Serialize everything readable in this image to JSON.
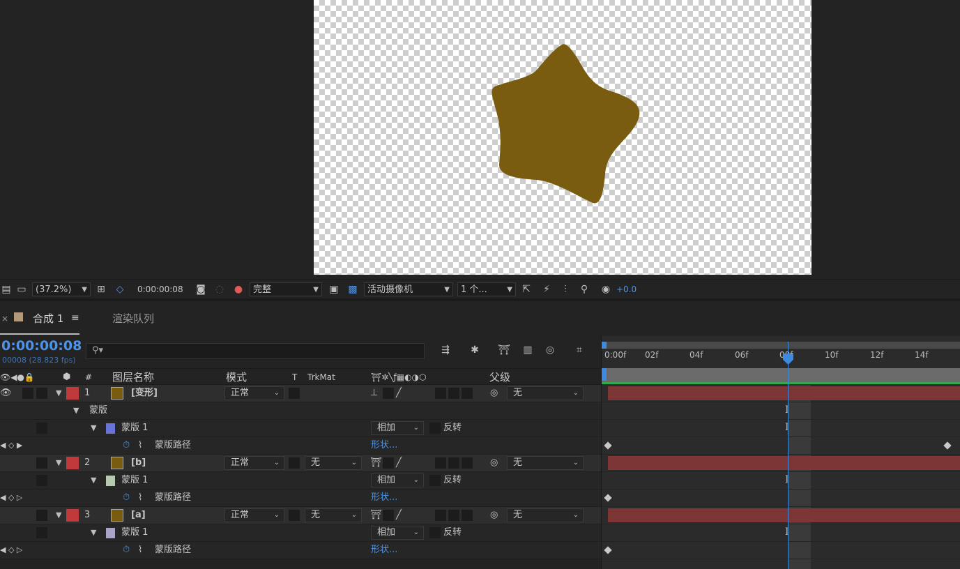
{
  "viewer": {
    "zoom": "(37.2%)",
    "timecode": "0:00:00:08",
    "resolution": "完整",
    "camera": "活动摄像机",
    "views": "1 个...",
    "exposure": "+0.0",
    "star_color": "#7a5c10"
  },
  "tabs": {
    "comp_close": "×",
    "comp_label": "合成 1",
    "menu": "≡",
    "render_queue": "渲染队列"
  },
  "timeline": {
    "current_time": "0:00:00:08",
    "frame_fps": "00008 (28.823 fps)",
    "search_placeholder": "",
    "columns": {
      "num": "#",
      "name": "图层名称",
      "mode": "模式",
      "t": "T",
      "trkmat": "TrkMat",
      "parent": "父级"
    },
    "ruler": [
      "0:00f",
      "02f",
      "04f",
      "06f",
      "08f",
      "10f",
      "12f",
      "14f"
    ],
    "rows": [
      {
        "num": "1",
        "name": "[变形]",
        "mode": "正常",
        "trkmat": "",
        "parent": "无"
      },
      {
        "label": "蒙版"
      },
      {
        "label": "蒙版 1",
        "mask_mode": "相加",
        "invert": "反转"
      },
      {
        "label": "蒙版路径",
        "value": "形状..."
      },
      {
        "num": "2",
        "name": "[b]",
        "mode": "正常",
        "trkmat": "无",
        "parent": "无"
      },
      {
        "label": "蒙版 1",
        "mask_mode": "相加",
        "invert": "反转"
      },
      {
        "label": "蒙版路径",
        "value": "形状..."
      },
      {
        "num": "3",
        "name": "[a]",
        "mode": "正常",
        "trkmat": "无",
        "parent": "无"
      },
      {
        "label": "蒙版 1",
        "mask_mode": "相加",
        "invert": "反转"
      },
      {
        "label": "蒙版路径",
        "value": "形状..."
      }
    ],
    "colors": {
      "label_red": "#c0393b",
      "layer_swatch": "#7a5c10",
      "mask1_color": "#6a74d8",
      "mask2_color": "#b5c9b0",
      "mask3_color": "#a9a3c9",
      "bar": "#7d3636",
      "playhead": "#3d8be0"
    }
  }
}
